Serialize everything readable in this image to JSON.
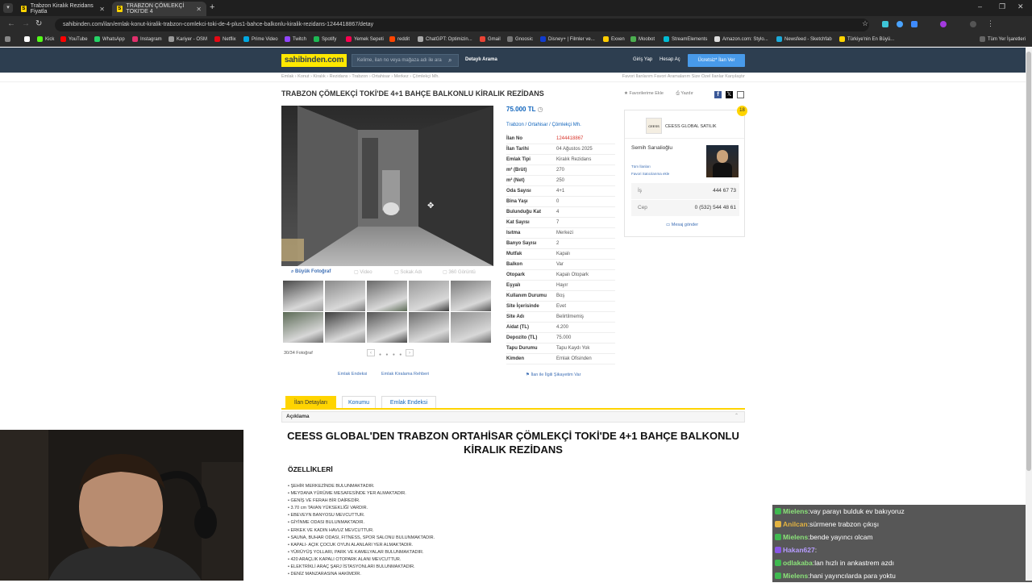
{
  "browser": {
    "tabs": [
      {
        "title": "Trabzon Kiralık Rezidans Fiyatla"
      },
      {
        "title": "TRABZON ÇÖMLEKÇİ TOKİ'DE 4"
      }
    ],
    "url": "sahibinden.com/ilan/emlak-konut-kiralik-trabzon-comlekci-toki-de-4-plus1-bahce-balkonlu-kiralik-rezidans-1244418867/detay",
    "bookmarks": [
      "Kick",
      "YouTube",
      "WhatsApp",
      "Instagram",
      "Kariyer - OSM",
      "Netflix",
      "Prime Video",
      "Twitch",
      "Spotify",
      "Yemek Sepeti",
      "reddit",
      "ChatGPT: Optimizin...",
      "Gmail",
      "Gnoosic",
      "Disney+ | Filmler ve...",
      "Exxen",
      "Moobot",
      "StreamElements",
      "Amazon.com: Stylo...",
      "Newsfeed - Sketchfab",
      "Türkiye'nin En Büyü..."
    ],
    "bookmarks_all": "Tüm Yer İşaretleri"
  },
  "site": {
    "logo": "sahibinden.com",
    "search_placeholder": "Kelime, ilan no veya mağaza adı ile ara",
    "detailed_search": "Detaylı Arama",
    "login": "Giriş Yap",
    "register": "Hesap Aç",
    "post_ad": "Ücretsiz* İlan Ver",
    "breadcrumb": "Emlak  ›  Konut  ›  Kiralık  ›  Rezidans  ›  Trabzon  ›  Ortahisar  ›  Merkez  ›  Çömlekçi Mh.",
    "top_links": "Favori İlanlarım    Favori Aramalarım    Size Özel İlanlar    Karşılaştır"
  },
  "listing": {
    "title": "TRABZON ÇÖMLEKÇİ TOKİ'DE 4+1 BAHÇE BALKONLU KİRALIK REZİDANS",
    "actions": {
      "favorite": "Favorilerime Ekle",
      "print": "Yazdır"
    },
    "price": "75.000 TL",
    "location": "Trabzon  /  Ortahisar  /  Çömlekçi Mh.",
    "photo_buttons": {
      "big": "Büyük Fotoğraf",
      "video": "Video",
      "satellite": "Sokak Adı",
      "map": "360 Görüntü"
    },
    "photo_count": "30/34 Fotoğraf",
    "details": [
      {
        "k": "İlan No",
        "v": "1244418867"
      },
      {
        "k": "İlan Tarihi",
        "v": "04 Ağustos 2025"
      },
      {
        "k": "Emlak Tipi",
        "v": "Kiralık Rezidans"
      },
      {
        "k": "m² (Brüt)",
        "v": "270"
      },
      {
        "k": "m² (Net)",
        "v": "250"
      },
      {
        "k": "Oda Sayısı",
        "v": "4+1"
      },
      {
        "k": "Bina Yaşı",
        "v": "0"
      },
      {
        "k": "Bulunduğu Kat",
        "v": "4"
      },
      {
        "k": "Kat Sayısı",
        "v": "7"
      },
      {
        "k": "Isıtma",
        "v": "Merkezi"
      },
      {
        "k": "Banyo Sayısı",
        "v": "2"
      },
      {
        "k": "Mutfak",
        "v": "Kapalı"
      },
      {
        "k": "Balkon",
        "v": "Var"
      },
      {
        "k": "Otopark",
        "v": "Kapalı Otopark"
      },
      {
        "k": "Eşyalı",
        "v": "Hayır"
      },
      {
        "k": "Kullanım Durumu",
        "v": "Boş"
      },
      {
        "k": "Site İçerisinde",
        "v": "Evet"
      },
      {
        "k": "Site Adı",
        "v": "Belirtilmemiş"
      },
      {
        "k": "Aidat (TL)",
        "v": "4.200"
      },
      {
        "k": "Depozito (TL)",
        "v": "75.000"
      },
      {
        "k": "Tapu Durumu",
        "v": "Tapu Kaydı Yok"
      },
      {
        "k": "Kimden",
        "v": "Emlak Ofisinden"
      }
    ],
    "below_links": {
      "index": "Emlak Endeksi",
      "guide": "Emlak Kiralama Rehberi",
      "complaint": "İlan ile İlgili Şikayetim Var"
    }
  },
  "seller": {
    "store": "CEESS GLOBAL SATILIK",
    "name": "Semih Sarıalioğlu",
    "all_ads": "Tüm İlanları",
    "fav": "Favori Satıcılarıma ekle",
    "phones": [
      {
        "label": "İş",
        "value": "444 67 73"
      },
      {
        "label": "Cep",
        "value": "0 (532) 544 48 61"
      }
    ],
    "message": "Mesaj gönder"
  },
  "detail_tabs": [
    "İlan Detayları",
    "Konumu",
    "Emlak Endeksi"
  ],
  "description": {
    "header": "Açıklama",
    "title": "CEESS GLOBAL'DEN TRABZON ORTAHİSAR ÇÖMLEKÇİ TOKİ'DE 4+1 BAHÇE BALKONLU KİRALIK REZİDANS",
    "features_title": "ÖZELLİKLERİ",
    "features": [
      "ŞEHİR MERKEZİNDE BULUNMAKTADIR.",
      "MEYDANA YÜRÜME MESAFESİNDE YER ALMAKTADIR.",
      "GENİŞ VE FERAH BİR DAİREDİR.",
      "3.70 cm TAVAN YÜKSEKLİĞİ VARDIR.",
      "EBEVEYN BANYOSU MEVCUTTUR.",
      "GİYİNME ODASI BULUNMAKTADIR.",
      "ERKEK VE KADIN HAVUZ MEVCUTTUR.",
      "SAUNA, BUHAR ODASI, FITNESS, SPOR SALONU BULUNMAKTADIR.",
      "KAPALI- AÇIK ÇOCUK OYUN ALANLARI YER ALMAKTADIR.",
      "YÜRÜYÜŞ YOLLARI, PARK VE KAMELYALAR BULUNMAKTADIR.",
      "420 ARAÇLIK KAPALI OTOPARK ALANI MEVCUTTUR.",
      "ELEKTRİKLİ ARAÇ ŞARJ İSTASYONLARI BULUNMAKTADIR.",
      "DENİZ MANZARASINA HAKİMDİR."
    ]
  },
  "chat": [
    {
      "user": "Mielens",
      "msg": "vay parayı bulduk ev bakıyoruz",
      "badge": "#3fb950"
    },
    {
      "user": "Anilcan",
      "msg": "sürmene trabzon çıkışı",
      "badge": "#e3b341"
    },
    {
      "user": "Mielens",
      "msg": "bende yayıncı olcam",
      "badge": "#3fb950"
    },
    {
      "user": "Hakan627",
      "msg": "",
      "badge": "#8957e5"
    },
    {
      "user": "odlakaba",
      "msg": "lan hızlı in ankastrem azdı",
      "badge": "#3fb950"
    },
    {
      "user": "Mielens",
      "msg": "hani yayıncılarda para yoktu",
      "badge": "#3fb950"
    }
  ]
}
